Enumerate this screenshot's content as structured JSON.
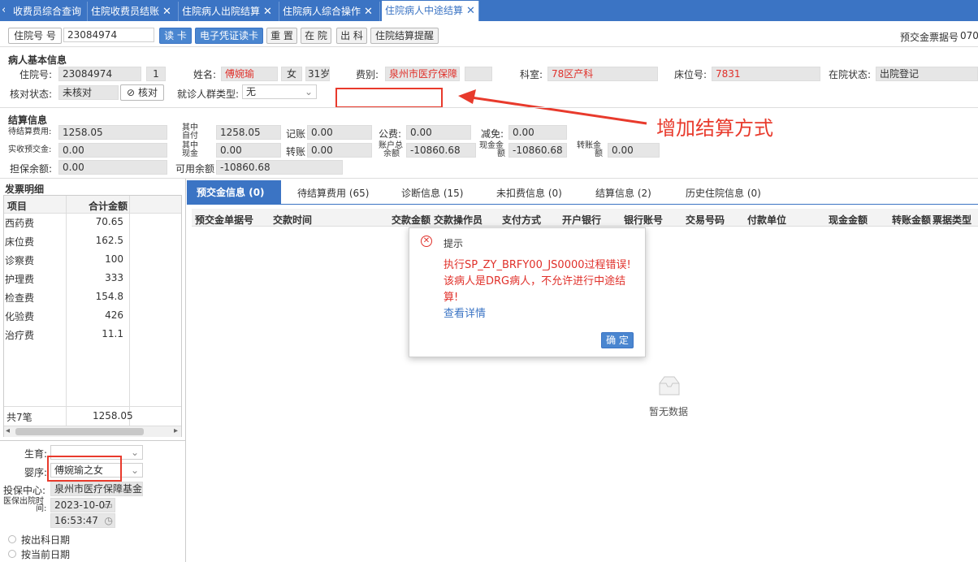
{
  "tabs": [
    {
      "label": "收费员综合查询",
      "closable": false,
      "active": false
    },
    {
      "label": "住院收费员结账",
      "closable": true,
      "active": false
    },
    {
      "label": "住院病人出院结算",
      "closable": true,
      "active": false
    },
    {
      "label": "住院病人综合操作",
      "closable": true,
      "active": false
    },
    {
      "label": "住院病人中途结算",
      "closable": true,
      "active": true
    }
  ],
  "toolbar": {
    "search_type": "住院号",
    "search_type_suffix": "号",
    "search_value": "23084974",
    "buttons": [
      "读 卡",
      "电子凭证读卡",
      "重 置",
      "在 院",
      "出 科",
      "住院结算提醒"
    ],
    "receipt_label": "预交金票据号",
    "receipt_value": "070"
  },
  "patient": {
    "section": "病人基本信息",
    "id_label": "住院号:",
    "id_value": "23084974",
    "seq": "1",
    "name_label": "姓名:",
    "name_value": "傅婉瑜",
    "sex": "女",
    "age": "31岁",
    "fee_label": "费别:",
    "fee_value": "泉州市医疗保障",
    "dept_label": "科室:",
    "dept_value": "78区产科",
    "bed_label": "床位号:",
    "bed_value": "7831",
    "status_label": "在院状态:",
    "status_value": "出院登记",
    "check_label": "核对状态:",
    "check_value": "未核对",
    "check_button": "核对",
    "crowd_label": "就诊人群类型:",
    "crowd_value": "无"
  },
  "annotation": "增加结算方式",
  "settlement": {
    "section": "结算信息",
    "pending_label": "待结算费用:",
    "pending_value": "1258.05",
    "self_label_1": "其中",
    "self_label_2": "自付",
    "self_value": "1258.05",
    "account_label": "记账",
    "account_value": "0.00",
    "public_label": "公费:",
    "public_value": "0.00",
    "reduce_label": "减免:",
    "reduce_value": "0.00",
    "prepaid_label": "实收预交金:",
    "prepaid_value": "0.00",
    "cash_label_1": "其中",
    "cash_label_2": "现金",
    "cash_value": "0.00",
    "transfer_label": "转账",
    "transfer_value": "0.00",
    "account_bal_1": "账户总",
    "account_bal_2": "余额",
    "account_bal_value": "-10860.68",
    "cash_amt_1": "现金金",
    "cash_amt_2": "额",
    "cash_amt_value": "-10860.68",
    "transfer_amt_1": "转账金",
    "transfer_amt_2": "额",
    "transfer_amt_value": "0.00",
    "guarantee_label": "担保余额:",
    "guarantee_value": "0.00",
    "available_label": "可用余额",
    "available_value": "-10860.68"
  },
  "invoice": {
    "section": "发票明细",
    "headers": [
      "项目",
      "合计金额"
    ],
    "rows": [
      {
        "name": "西药费",
        "amount": "70.65"
      },
      {
        "name": "床位费",
        "amount": "162.5"
      },
      {
        "name": "诊察费",
        "amount": "100"
      },
      {
        "name": "护理费",
        "amount": "333"
      },
      {
        "name": "检查费",
        "amount": "154.8"
      },
      {
        "name": "化验费",
        "amount": "426"
      },
      {
        "name": "治疗费",
        "amount": "11.1"
      }
    ],
    "total_label": "共7笔",
    "total_value": "1258.05"
  },
  "birth": {
    "birth_label": "生育:",
    "birth_value": "",
    "infant_label": "婴序:",
    "infant_value": "傅婉瑜之女",
    "center_label": "投保中心:",
    "center_value": "泉州市医疗保障基金",
    "discharge_label_1": "医保出院时",
    "discharge_label_2": "间:",
    "discharge_date": "2023-10-07",
    "discharge_time": "16:53:47",
    "radio1": "按出科日期",
    "radio2": "按当前日期"
  },
  "bottom_tabs": [
    {
      "label": "预交金信息",
      "count": "(0)"
    },
    {
      "label": "待结算费用",
      "count": "(65)"
    },
    {
      "label": "诊断信息",
      "count": "(15)"
    },
    {
      "label": "未扣费信息",
      "count": "(0)"
    },
    {
      "label": "结算信息",
      "count": "(2)"
    },
    {
      "label": "历史住院信息",
      "count": "(0)"
    }
  ],
  "grid_headers": [
    "预交金单据号",
    "交款时间",
    "交款金额",
    "交款操作员",
    "支付方式",
    "开户银行",
    "银行账号",
    "交易号码",
    "付款单位",
    "现金金额",
    "转账金额",
    "票据类型"
  ],
  "empty_text": "暂无数据",
  "dialog": {
    "title": "提示",
    "line1": "执行SP_ZY_BRFY00_JS0000过程错误!",
    "line2": "该病人是DRG病人，不允许进行中途结",
    "line3": "算!",
    "link": "查看详情",
    "ok": "确 定"
  },
  "colors": {
    "accent": "#3b74c4",
    "error": "#e0302a",
    "annotation": "#e83a2c"
  }
}
